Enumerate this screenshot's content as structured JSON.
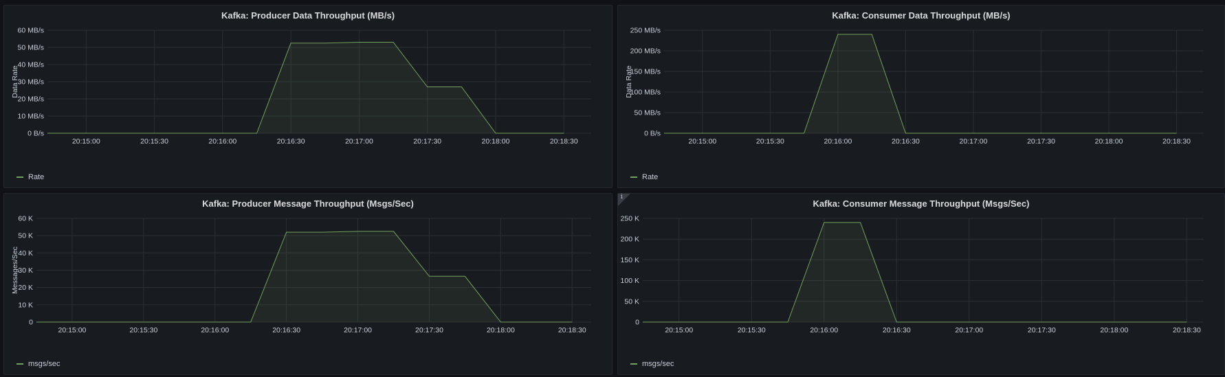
{
  "theme": {
    "line_color": "#73a05e",
    "fill_color": "#73a05e",
    "grid_color": "#2c3036",
    "background": "#181b1f"
  },
  "chart_data": [
    {
      "type": "area",
      "title": "Kafka: Producer Data Throughput (MB/s)",
      "ylabel": "Data Rate",
      "xlim": [
        "20:14:43",
        "20:18:42"
      ],
      "x_ticks": [
        "20:15:00",
        "20:15:30",
        "20:16:00",
        "20:16:30",
        "20:17:00",
        "20:17:30",
        "20:18:00",
        "20:18:30"
      ],
      "ylim": [
        0,
        60
      ],
      "y_ticks": [
        0,
        10,
        20,
        30,
        40,
        50,
        60
      ],
      "y_tick_labels": [
        "0 B/s",
        "10 MB/s",
        "20 MB/s",
        "30 MB/s",
        "40 MB/s",
        "50 MB/s",
        "60 MB/s"
      ],
      "series": [
        {
          "name": "Rate",
          "x": [
            "20:14:43",
            "20:16:15",
            "20:16:30",
            "20:16:45",
            "20:17:00",
            "20:17:15",
            "20:17:30",
            "20:17:45",
            "20:18:00",
            "20:18:30"
          ],
          "values": [
            0,
            0,
            52.5,
            52.5,
            53,
            53,
            27,
            27,
            0,
            0
          ]
        }
      ],
      "grid": true,
      "legend": "bottom-left"
    },
    {
      "type": "area",
      "title": "Kafka: Consumer Data Throughput (MB/s)",
      "ylabel": "Data Rate",
      "xlim": [
        "20:14:43",
        "20:18:42"
      ],
      "x_ticks": [
        "20:15:00",
        "20:15:30",
        "20:16:00",
        "20:16:30",
        "20:17:00",
        "20:17:30",
        "20:18:00",
        "20:18:30"
      ],
      "ylim": [
        0,
        250
      ],
      "y_ticks": [
        0,
        50,
        100,
        150,
        200,
        250
      ],
      "y_tick_labels": [
        "0 B/s",
        "50 MB/s",
        "100 MB/s",
        "150 MB/s",
        "200 MB/s",
        "250 MB/s"
      ],
      "series": [
        {
          "name": "Rate",
          "x": [
            "20:14:43",
            "20:15:45",
            "20:16:00",
            "20:16:15",
            "20:16:30",
            "20:18:30"
          ],
          "values": [
            0,
            0,
            240,
            240,
            0,
            0
          ]
        }
      ],
      "grid": true,
      "legend": "bottom-left"
    },
    {
      "type": "area",
      "title": "Kafka: Producer Message Throughput (Msgs/Sec)",
      "ylabel": "Messages/Sec",
      "xlim": [
        "20:14:45",
        "20:18:38"
      ],
      "x_ticks": [
        "20:15:00",
        "20:15:30",
        "20:16:00",
        "20:16:30",
        "20:17:00",
        "20:17:30",
        "20:18:00",
        "20:18:30"
      ],
      "ylim": [
        0,
        60000
      ],
      "y_ticks": [
        0,
        10000,
        20000,
        30000,
        40000,
        50000,
        60000
      ],
      "y_tick_labels": [
        "0",
        "10 K",
        "20 K",
        "30 K",
        "40 K",
        "50 K",
        "60 K"
      ],
      "series": [
        {
          "name": "msgs/sec",
          "x": [
            "20:14:45",
            "20:16:15",
            "20:16:30",
            "20:16:45",
            "20:17:00",
            "20:17:15",
            "20:17:30",
            "20:17:45",
            "20:18:00",
            "20:18:30"
          ],
          "values": [
            0,
            0,
            52000,
            52000,
            52500,
            52500,
            26500,
            26500,
            0,
            0
          ]
        }
      ],
      "grid": true,
      "legend": "bottom-left"
    },
    {
      "type": "area",
      "title": "Kafka: Consumer Message Throughput (Msgs/Sec)",
      "ylabel": "",
      "xlim": [
        "20:14:45",
        "20:18:37"
      ],
      "x_ticks": [
        "20:15:00",
        "20:15:30",
        "20:16:00",
        "20:16:30",
        "20:17:00",
        "20:17:30",
        "20:18:00",
        "20:18:30"
      ],
      "ylim": [
        0,
        250000
      ],
      "y_ticks": [
        0,
        50000,
        100000,
        150000,
        200000,
        250000
      ],
      "y_tick_labels": [
        "0",
        "50 K",
        "100 K",
        "150 K",
        "200 K",
        "250 K"
      ],
      "series": [
        {
          "name": "msgs/sec",
          "x": [
            "20:14:45",
            "20:15:45",
            "20:16:00",
            "20:16:15",
            "20:16:30",
            "20:18:30"
          ],
          "values": [
            0,
            0,
            240000,
            240000,
            0,
            0
          ]
        }
      ],
      "grid": true,
      "legend": "bottom-left",
      "info_icon": "info-icon"
    }
  ]
}
